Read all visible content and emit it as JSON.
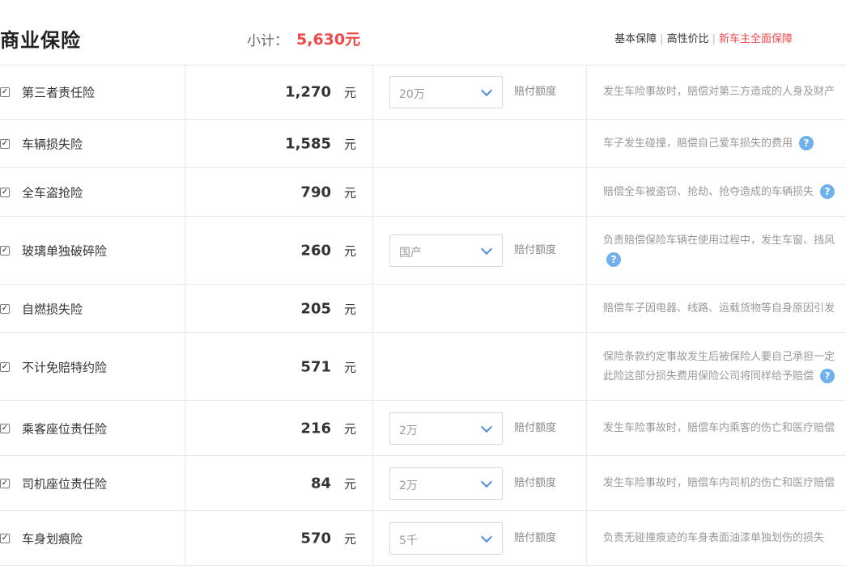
{
  "header": {
    "title": "商业保险",
    "subtotal_label": "小计：",
    "subtotal_value": "5,630元",
    "tabs": [
      "基本保障",
      "高性价比",
      "新车主全面保障"
    ]
  },
  "colors": {
    "accent": "#f04848",
    "help": "#6fb1ec",
    "chevron": "#4a8fd8"
  },
  "rows": [
    {
      "name": "第三者责任险",
      "amount": "1,270",
      "unit": "元",
      "checked": true,
      "option": {
        "value": "20万",
        "label": "赔付额度"
      },
      "desc": [
        "发生车险事故时，赔偿对第三方造成的人身及财产"
      ]
    },
    {
      "name": "车辆损失险",
      "amount": "1,585",
      "unit": "元",
      "checked": true,
      "desc": [
        "车子发生碰撞，赔偿自己爱车损失的费用"
      ]
    },
    {
      "name": "全车盗抢险",
      "amount": "790",
      "unit": "元",
      "checked": true,
      "desc": [
        "赔偿全车被盗窃、抢劫、抢夺造成的车辆损失"
      ]
    },
    {
      "name": "玻璃单独破碎险",
      "amount": "260",
      "unit": "元",
      "checked": true,
      "option": {
        "value": "国产",
        "label": "赔付额度"
      },
      "desc": [
        "负责赔偿保险车辆在使用过程中，发生车窗、挡风"
      ]
    },
    {
      "name": "自燃损失险",
      "amount": "205",
      "unit": "元",
      "checked": true,
      "desc": [
        "赔偿车子因电器、线路、运载货物等自身原因引发"
      ]
    },
    {
      "name": "不计免赔特约险",
      "amount": "571",
      "unit": "元",
      "checked": true,
      "desc": [
        "保险条款约定事故发生后被保险人要自己承担一定",
        "此险这部分损失费用保险公司将同样给予赔偿"
      ]
    },
    {
      "name": "乘客座位责任险",
      "amount": "216",
      "unit": "元",
      "checked": true,
      "option": {
        "value": "2万",
        "label": "赔付额度"
      },
      "desc": [
        "发生车险事故时，赔偿车内乘客的伤亡和医疗赔偿"
      ]
    },
    {
      "name": "司机座位责任险",
      "amount": "84",
      "unit": "元",
      "checked": true,
      "option": {
        "value": "2万",
        "label": "赔付额度"
      },
      "desc": [
        "发生车险事故时，赔偿车内司机的伤亡和医疗赔偿"
      ]
    },
    {
      "name": "车身划痕险",
      "amount": "570",
      "unit": "元",
      "checked": true,
      "option": {
        "value": "5千",
        "label": "赔付额度"
      },
      "desc": [
        "负责无碰撞痕迹的车身表面油漆单独划伤的损失"
      ]
    }
  ]
}
